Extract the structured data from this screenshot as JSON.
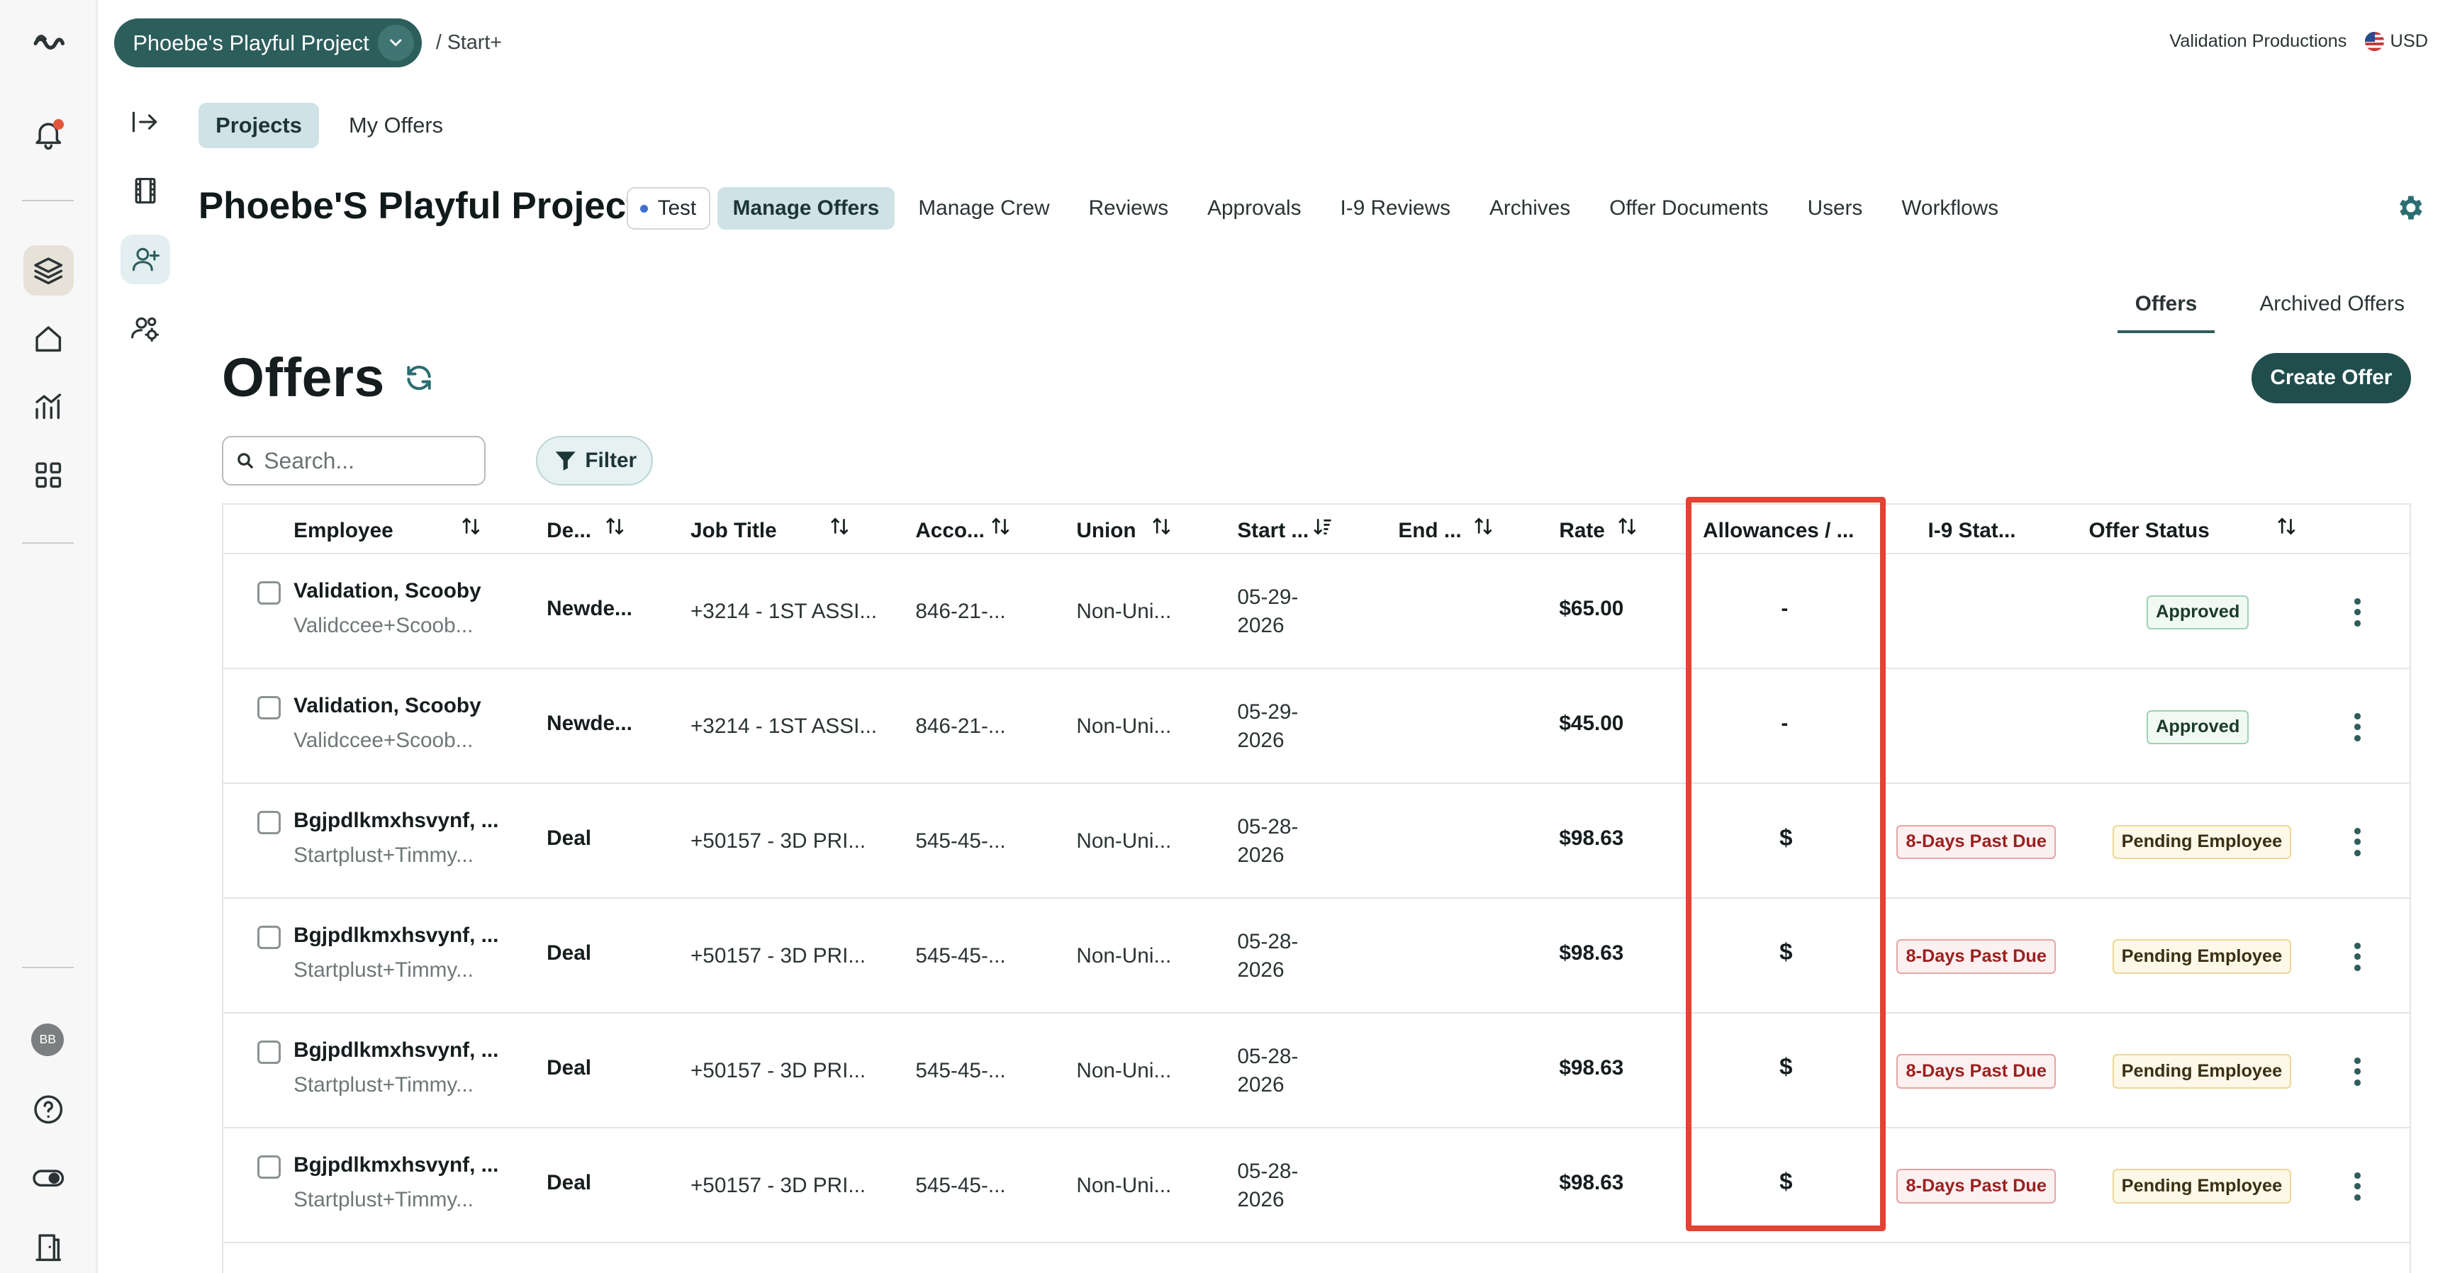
{
  "topbar": {
    "project_selector": "Phoebe's Playful Project",
    "breadcrumb": "/ Start+",
    "organization": "Validation Productions",
    "currency": "USD"
  },
  "user_initials": "BB",
  "top_tabs": [
    {
      "label": "Projects",
      "active": true
    },
    {
      "label": "My Offers",
      "active": false
    }
  ],
  "project": {
    "title": "Phoebe'S Playful Project",
    "badge": "Test",
    "nav": [
      {
        "label": "Manage Offers",
        "active": true
      },
      {
        "label": "Manage Crew",
        "active": false
      },
      {
        "label": "Reviews",
        "active": false
      },
      {
        "label": "Approvals",
        "active": false
      },
      {
        "label": "I-9 Reviews",
        "active": false
      },
      {
        "label": "Archives",
        "active": false
      },
      {
        "label": "Offer Documents",
        "active": false
      },
      {
        "label": "Users",
        "active": false
      },
      {
        "label": "Workflows",
        "active": false
      }
    ]
  },
  "offer_tabs": [
    {
      "label": "Offers",
      "active": true
    },
    {
      "label": "Archived Offers",
      "active": false
    }
  ],
  "page": {
    "heading": "Offers",
    "create_button": "Create Offer",
    "search_placeholder": "Search...",
    "filter_button": "Filter"
  },
  "table": {
    "columns": [
      "Employee",
      "De...",
      "Job Title",
      "Acco...",
      "Union",
      "Start ...",
      "End ...",
      "Rate",
      "Allowances / ...",
      "I-9 Stat...",
      "Offer Status"
    ],
    "rows": [
      {
        "name": "Validation, Scooby",
        "email": "Validccee+Scoob...",
        "dept": "Newde...",
        "job": "+3214 - 1ST ASSI...",
        "account": "846-21-...",
        "union": "Non-Uni...",
        "start_1": "05-29-",
        "start_2": "2026",
        "rate": "$65.00",
        "allowance": "-",
        "i9": "",
        "status": "Approved"
      },
      {
        "name": "Validation, Scooby",
        "email": "Validccee+Scoob...",
        "dept": "Newde...",
        "job": "+3214 - 1ST ASSI...",
        "account": "846-21-...",
        "union": "Non-Uni...",
        "start_1": "05-29-",
        "start_2": "2026",
        "rate": "$45.00",
        "allowance": "-",
        "i9": "",
        "status": "Approved"
      },
      {
        "name": "Bgjpdlkmxhsvynf, ...",
        "email": "Startplust+Timmy...",
        "dept": "Deal",
        "job": "+50157 - 3D PRI...",
        "account": "545-45-...",
        "union": "Non-Uni...",
        "start_1": "05-28-",
        "start_2": "2026",
        "rate": "$98.63",
        "allowance": "$",
        "i9": "8-Days Past Due",
        "status": "Pending Employee"
      },
      {
        "name": "Bgjpdlkmxhsvynf, ...",
        "email": "Startplust+Timmy...",
        "dept": "Deal",
        "job": "+50157 - 3D PRI...",
        "account": "545-45-...",
        "union": "Non-Uni...",
        "start_1": "05-28-",
        "start_2": "2026",
        "rate": "$98.63",
        "allowance": "$",
        "i9": "8-Days Past Due",
        "status": "Pending Employee"
      },
      {
        "name": "Bgjpdlkmxhsvynf, ...",
        "email": "Startplust+Timmy...",
        "dept": "Deal",
        "job": "+50157 - 3D PRI...",
        "account": "545-45-...",
        "union": "Non-Uni...",
        "start_1": "05-28-",
        "start_2": "2026",
        "rate": "$98.63",
        "allowance": "$",
        "i9": "8-Days Past Due",
        "status": "Pending Employee"
      },
      {
        "name": "Bgjpdlkmxhsvynf, ...",
        "email": "Startplust+Timmy...",
        "dept": "Deal",
        "job": "+50157 - 3D PRI...",
        "account": "545-45-...",
        "union": "Non-Uni...",
        "start_1": "05-28-",
        "start_2": "2026",
        "rate": "$98.63",
        "allowance": "$",
        "i9": "8-Days Past Due",
        "status": "Pending Employee"
      }
    ]
  },
  "colors": {
    "brand": "#2c5e5c",
    "highlight": "#e34234"
  },
  "icons": {
    "rail": [
      "logo-icon",
      "bell-icon",
      "layers-icon",
      "home-icon",
      "analytics-icon",
      "grid-icon",
      "help-icon",
      "toggle-icon",
      "door-icon"
    ],
    "subrail": [
      "collapse-icon",
      "film-icon",
      "add-user-icon",
      "team-settings-icon"
    ]
  }
}
